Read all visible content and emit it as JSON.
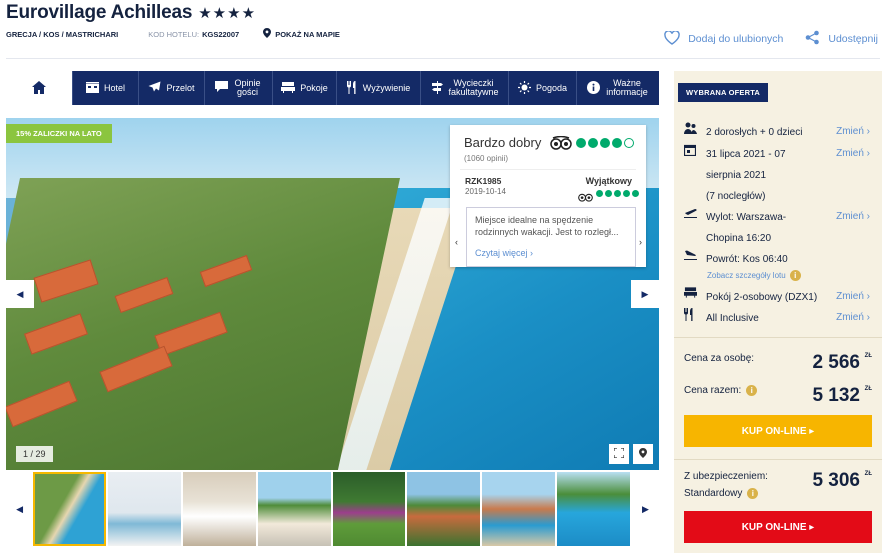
{
  "header": {
    "hotel_name": "Eurovillage Achilleas",
    "stars": "★★★★",
    "location": "GRECJA / KOS / MASTRICHARI",
    "code_label": "KOD HOTELU:",
    "code_value": "KGS22007",
    "map_link": "POKAŻ NA MAPIE",
    "favorite_label": "Dodaj do ulubionych",
    "share_label": "Udostępnij"
  },
  "nav": {
    "items": [
      {
        "label": "Hotel"
      },
      {
        "label": "Przelot"
      },
      {
        "label": "Opinie gości"
      },
      {
        "label": "Pokoje"
      },
      {
        "label": "Wyżywienie"
      },
      {
        "label": "Wycieczki fakultatywne"
      },
      {
        "label": "Pogoda"
      },
      {
        "label": "Ważne informacje"
      }
    ]
  },
  "gallery": {
    "promo": "15% ZALICZKI NA LATO",
    "counter": "1 / 29"
  },
  "review": {
    "rating_text": "Bardzo dobry",
    "count": "(1060 opinii)",
    "rating": 4,
    "rating_max": 5,
    "user": "RZK1985",
    "date": "2019-10-14",
    "verdict": "Wyjątkowy",
    "user_rating": 5,
    "quote": "Miejsce idealne na spędzenie rodzinnych wakacji. Jest to rozległ...",
    "more": "Czytaj więcej"
  },
  "offer": {
    "tag": "WYBRANA OFERTA",
    "change_label": "Zmień",
    "guests": "2 dorosłych + 0 dzieci",
    "dates_line1": "31 lipca 2021 - 07",
    "dates_line2": "sierpnia 2021",
    "dates_line3": "(7 nocległów)",
    "departure_line1": "Wylot: Warszawa-",
    "departure_line2": "Chopina 16:20",
    "return": "Powrót: Kos 06:40",
    "flight_details": "Zobacz szczegóły lotu",
    "room": "Pokój 2-osobowy (DZX1)",
    "board": "All Inclusive",
    "per_person_label": "Cena za osobę:",
    "per_person_value": "2 566",
    "total_label": "Cena razem:",
    "total_value": "5 132",
    "currency": "ZŁ",
    "buy_label": "KUP ON-LINE ▸",
    "insured_label_1": "Z ubezpieczeniem:",
    "insured_label_2": "Standardowy",
    "insured_value": "5 306"
  },
  "colors": {
    "navy": "#142a66",
    "accent_blue": "#5d8fd1",
    "promo_green": "#8bc53f",
    "buy_yellow": "#f7b500",
    "buy_red": "#e30b17",
    "panel_bg": "#f6f1e2"
  }
}
